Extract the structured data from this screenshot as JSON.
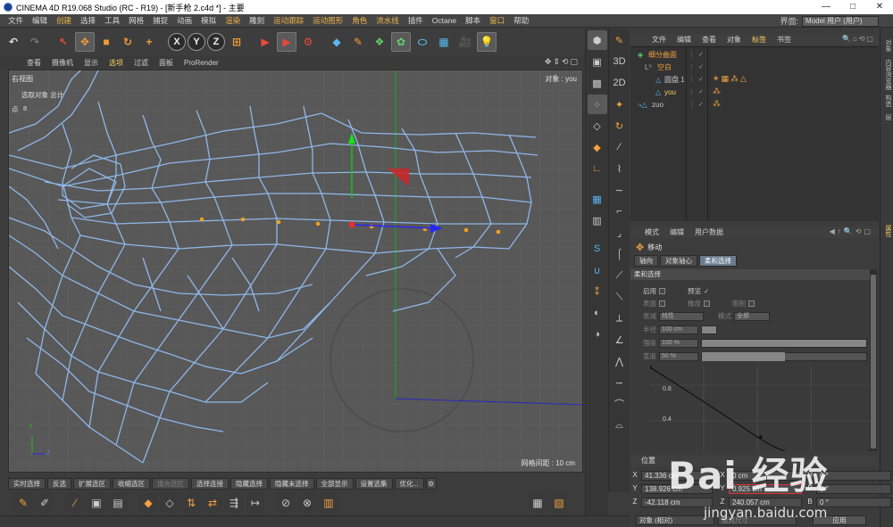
{
  "window": {
    "title": "CINEMA 4D R19.068 Studio (RC - R19) - [新手枪 2.c4d *] - 主要",
    "minimize": "—",
    "maximize": "□",
    "close": "✕"
  },
  "menubar": {
    "items": [
      "文件",
      "编辑",
      "创建",
      "选择",
      "工具",
      "网格",
      "捕捉",
      "动画",
      "模拟",
      "渲染",
      "雕刻",
      "运动跟踪",
      "运动图形",
      "角色",
      "流水线",
      "插件",
      "Octane",
      "脚本",
      "窗口",
      "帮助"
    ],
    "highlighted": [
      "创建",
      "渲染",
      "运动跟踪",
      "运动图形",
      "角色",
      "流水线",
      "窗口"
    ],
    "layout_label": "界面:",
    "layout_value": "Model 用户 (用户)"
  },
  "viewport_menu": {
    "items": [
      "查看",
      "摄像机",
      "显示",
      "选项",
      "过滤",
      "面板",
      "ProRender"
    ],
    "active": "选项"
  },
  "viewport": {
    "view_name": "右视图",
    "selection_info_title": "选取对象 总计",
    "selection_info_icon": "点",
    "selection_info_count": "8",
    "camera_label": "对象 : you",
    "grid_spacing": "网格间距 : 10 cm",
    "axis_y": "Y",
    "axis_z": "Z"
  },
  "selection_bar": {
    "items": [
      "实时选择",
      "反选",
      "扩展选区",
      "收缩选区",
      "填充选区",
      "选择连接",
      "隐藏选择",
      "隐藏未选择",
      "全部显示",
      "设置选集",
      "优化..."
    ],
    "dim": [
      "填充选区"
    ]
  },
  "object_manager": {
    "tabs": [
      "文件",
      "编辑",
      "查看",
      "对象",
      "标签",
      "书签"
    ],
    "active_tab": "标签",
    "objects": [
      {
        "name": "细分曲面",
        "color": "#f2a040",
        "indent": 8
      },
      {
        "name": "空白",
        "color": "#f2a040",
        "indent": 16
      },
      {
        "name": "圆盘.1",
        "color": "#c8c8c8",
        "indent": 28
      },
      {
        "name": "you",
        "color": "#f2d060",
        "indent": 28
      },
      {
        "name": "zuo",
        "color": "#c8c8c8",
        "indent": 16
      }
    ]
  },
  "attribute_manager": {
    "tabs": [
      "模式",
      "编辑",
      "用户数据"
    ],
    "tool_name": "移动",
    "subtabs": [
      "轴向",
      "对象轴心",
      "柔和选择"
    ],
    "active_subtab": "柔和选择",
    "section": "柔和选择",
    "enable_label": "启用",
    "preview_label": "预览",
    "preview_check": "✓",
    "surface_label": "表面",
    "rubber_label": "橡皮",
    "restrict_label": "限制",
    "mode_label": "模式",
    "mode_value": "全部",
    "falloff_label": "衰减",
    "falloff_value": "线性",
    "radius_label": "半径",
    "radius_value": "100 cm",
    "strength_label": "强度",
    "strength_value": "100 %",
    "width_label": "宽度",
    "width_value": "50 %",
    "graph_ticks": [
      "0.8",
      "0.4"
    ]
  },
  "coordinates": {
    "header": "位置",
    "rows": [
      {
        "axis": "X",
        "pos": "41.336 cm",
        "size_axis": "X",
        "size": "0 cm",
        "rot_axis": "H",
        "rot": "0 °"
      },
      {
        "axis": "Y",
        "pos": "138.926 cm",
        "size_axis": "Y",
        "size": "0.925 cm",
        "rot_axis": "P",
        "rot": "0 °"
      },
      {
        "axis": "Z",
        "pos": "-42.118 cm",
        "size_axis": "Z",
        "size": "240.057 cm",
        "rot_axis": "B",
        "rot": "0 °"
      }
    ],
    "mode_value": "对象 (相对)",
    "size_mode_value": "绝对尺寸",
    "apply_label": "应用"
  },
  "side_tabs": [
    "对象",
    "内容浏览器",
    "构造",
    "层",
    "属性"
  ],
  "active_side_tab": "属性",
  "watermark": {
    "main": "Bai 经验",
    "sub": "jingyan.baidu.com"
  },
  "colors": {
    "accent": "#f2a040",
    "active_text": "#ffd060",
    "mesh": "#8fb7e8",
    "point": "#f0a020",
    "axis_green": "#18c018",
    "axis_blue": "#2828f0",
    "axis_red": "#e83030"
  }
}
